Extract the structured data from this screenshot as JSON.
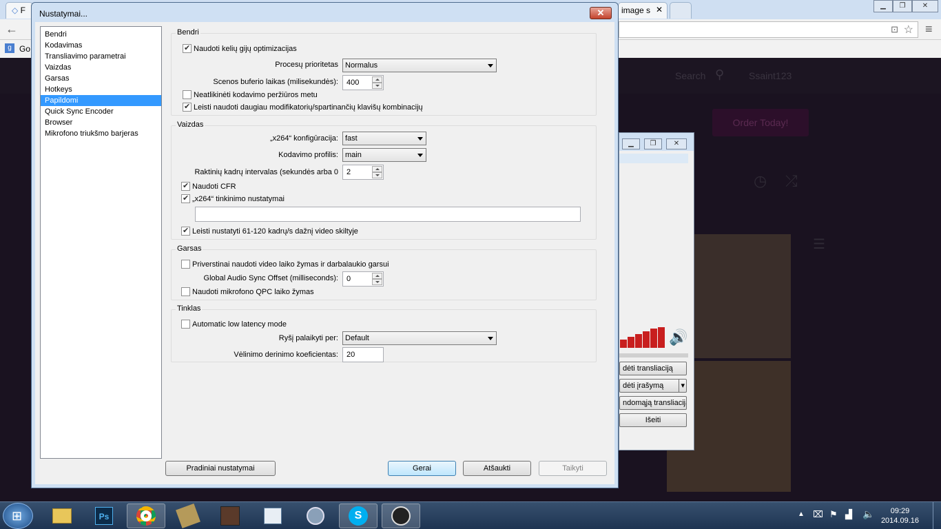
{
  "browser": {
    "tab1_title": "F",
    "tab2_title": "image s",
    "bookmark_label": "Go",
    "site_search": "Search",
    "site_user": "Ssaint123",
    "order_button": "Order Today!"
  },
  "obs": {
    "btn_start_stream": "dėti transliaciją",
    "btn_start_record": "dėti įrašymą",
    "btn_test_stream": "ndomąją transliaciją",
    "btn_exit": "Išeiti"
  },
  "dialog": {
    "title": "Nustatymai...",
    "sidebar": [
      {
        "label": "Bendri",
        "selected": false
      },
      {
        "label": "Kodavimas",
        "selected": false
      },
      {
        "label": "Transliavimo parametrai",
        "selected": false
      },
      {
        "label": "Vaizdas",
        "selected": false
      },
      {
        "label": "Garsas",
        "selected": false
      },
      {
        "label": "Hotkeys",
        "selected": false
      },
      {
        "label": "Papildomi",
        "selected": true
      },
      {
        "label": "Quick Sync Encoder",
        "selected": false
      },
      {
        "label": "Browser",
        "selected": false
      },
      {
        "label": "Mikrofono triukšmo barjeras",
        "selected": false
      }
    ],
    "general": {
      "title": "Bendri",
      "multithread_label": "Naudoti kelių gijų optimizacijas",
      "multithread_checked": true,
      "priority_label": "Procesų prioritetas",
      "priority_value": "Normalus",
      "buffer_label": "Scenos buferio laikas (milisekundės):",
      "buffer_value": "400",
      "no_preview_label": "Neatlikinėti kodavimo peržiūros metu",
      "no_preview_checked": false,
      "modifier_label": "Leisti naudoti daugiau modifikatorių/spartinančių klavišų kombinacijų",
      "modifier_checked": true
    },
    "video": {
      "title": "Vaizdas",
      "x264_preset_label": "„x264“ konfigūracija:",
      "x264_preset_value": "fast",
      "profile_label": "Kodavimo profilis:",
      "profile_value": "main",
      "keyframe_label": "Raktinių kadrų intervalas (sekundės arba 0",
      "keyframe_value": "2",
      "cfr_label": "Naudoti CFR",
      "cfr_checked": true,
      "x264_custom_label": "„x264“ tinkinimo nustatymai",
      "x264_custom_checked": true,
      "x264_custom_value": "",
      "fps_label": "Leisti nustatyti 61-120 kadrų/s dažnį video skiltyje",
      "fps_checked": true
    },
    "audio": {
      "title": "Garsas",
      "force_ts_label": "Priverstinai naudoti video laiko žymas ir darbalaukio garsui",
      "force_ts_checked": false,
      "sync_label": "Global Audio Sync Offset (milliseconds):",
      "sync_value": "0",
      "qpc_label": "Naudoti mikrofono QPC laiko žymas",
      "qpc_checked": false
    },
    "network": {
      "title": "Tinklas",
      "low_latency_label": "Automatic low latency mode",
      "low_latency_checked": false,
      "bind_label": "Ryšį palaikyti per:",
      "bind_value": "Default",
      "latency_factor_label": "Vėlinimo derinimo koeficientas:",
      "latency_factor_value": "20"
    },
    "buttons": {
      "defaults": "Pradiniai nustatymai",
      "ok": "Gerai",
      "cancel": "Atšaukti",
      "apply": "Taikyti"
    }
  },
  "taskbar": {
    "time": "09:29",
    "date": "2014.09.16"
  },
  "colors": {
    "selection": "#3399ff",
    "taskbar": "#1e3452",
    "audio_meter": "#c81e1e"
  }
}
